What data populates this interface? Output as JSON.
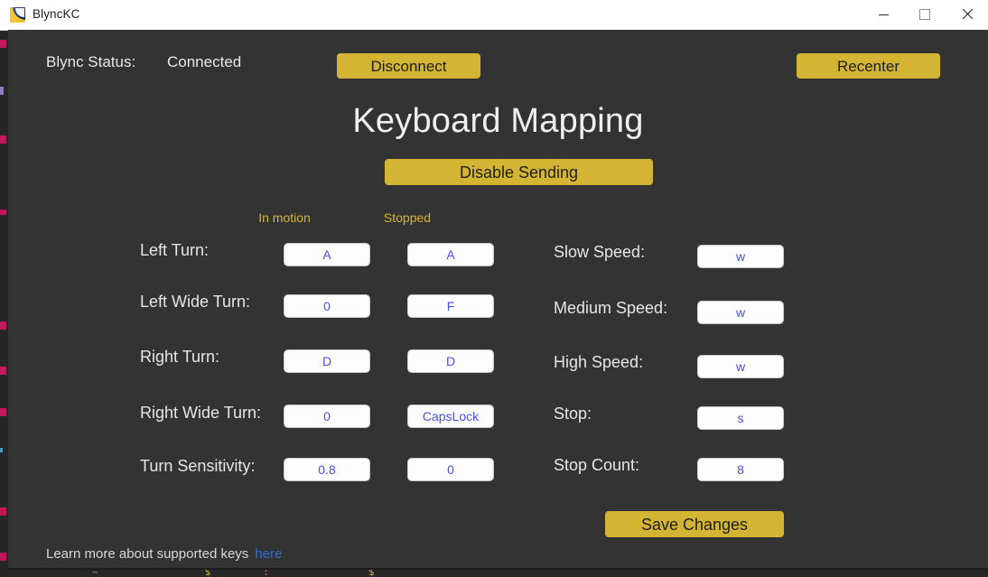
{
  "window": {
    "title": "BlyncKC",
    "icon": "blync-app-icon",
    "controls": {
      "minimize": "minimize-icon",
      "maximize": "maximize-icon",
      "close": "close-icon"
    }
  },
  "colors": {
    "app_background": "#333333",
    "accent_gold": "#d4b533",
    "field_text": "#4a50e8",
    "link": "#2f6fd0",
    "label_text": "#e6e6e6",
    "titlebar_background": "#ffffff"
  },
  "header": {
    "status_label": "Blync Status:",
    "status_value": "Connected",
    "disconnect_label": "Disconnect",
    "recenter_label": "Recenter"
  },
  "main": {
    "title": "Keyboard Mapping",
    "disable_sending_label": "Disable Sending",
    "save_changes_label": "Save Changes"
  },
  "columns": {
    "in_motion": "In motion",
    "stopped": "Stopped"
  },
  "left_rows": [
    {
      "label": "Left Turn:",
      "in_motion": "A",
      "stopped": "A"
    },
    {
      "label": "Left Wide Turn:",
      "in_motion": "0",
      "stopped": "F"
    },
    {
      "label": "Right Turn:",
      "in_motion": "D",
      "stopped": "D"
    },
    {
      "label": "Right Wide Turn:",
      "in_motion": "0",
      "stopped": "CapsLock"
    },
    {
      "label": "Turn Sensitivity:",
      "in_motion": "0.8",
      "stopped": "0"
    }
  ],
  "right_rows": [
    {
      "label": "Slow Speed:",
      "value": "w"
    },
    {
      "label": "Medium Speed:",
      "value": "w"
    },
    {
      "label": "High Speed:",
      "value": "w"
    },
    {
      "label": "Stop:",
      "value": "s"
    },
    {
      "label": "Stop Count:",
      "value": "8"
    }
  ],
  "footer": {
    "note": "Learn more about supported keys",
    "link": "here"
  }
}
